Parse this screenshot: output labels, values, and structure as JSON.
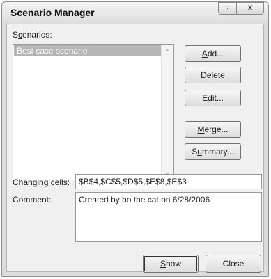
{
  "window": {
    "title": "Scenario Manager",
    "help_button": "?",
    "close_button": "X"
  },
  "scenarios": {
    "label_pre": "S",
    "label_accel": "c",
    "label_post": "enarios:",
    "items": [
      "Best case scenario"
    ],
    "selected_index": 0
  },
  "buttons": {
    "add": {
      "accel": "A",
      "rest": "dd..."
    },
    "delete": {
      "accel": "D",
      "rest": "elete"
    },
    "edit": {
      "accel": "E",
      "rest": "dit..."
    },
    "merge": {
      "accel": "M",
      "rest": "erge..."
    },
    "summary": {
      "pre": "S",
      "accel": "u",
      "rest": "mmary..."
    },
    "show": {
      "accel": "S",
      "rest": "how"
    },
    "close": {
      "label": "Close"
    }
  },
  "changing_cells": {
    "label": "Changing cells:",
    "value": "$B$4,$C$5,$D$5,$E$8,$E$3"
  },
  "comment": {
    "label": "Comment:",
    "value": "Created by bo the cat on 6/28/2006"
  }
}
